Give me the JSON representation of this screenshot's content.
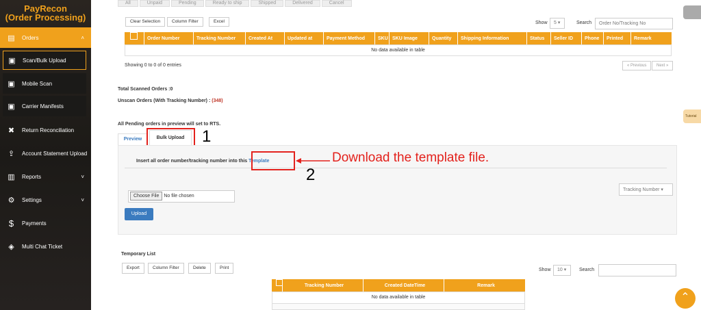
{
  "sidebar": {
    "brand_line1": "PayRecon",
    "brand_line2": "(Order Processing)",
    "items": [
      {
        "label": "Orders",
        "icon": "clipboard-icon"
      },
      {
        "label": "Scan/Bulk Upload",
        "icon": "document-icon"
      },
      {
        "label": "Mobile Scan",
        "icon": "document-icon"
      },
      {
        "label": "Carrier Manifests",
        "icon": "document-icon"
      },
      {
        "label": "Return Reconciliation",
        "icon": "excel-icon"
      },
      {
        "label": "Account Statement Upload",
        "icon": "upload-icon"
      },
      {
        "label": "Reports",
        "icon": "bar-chart-icon"
      },
      {
        "label": "Settings",
        "icon": "gear-icon"
      },
      {
        "label": "Payments",
        "icon": "dollar-icon"
      },
      {
        "label": "Multi Chat Ticket",
        "icon": "ticket-icon"
      }
    ]
  },
  "top_tabs": [
    "All",
    "Unpaid",
    "Pending",
    "Ready to ship",
    "Shipped",
    "Delivered",
    "Cancel"
  ],
  "orders_table": {
    "buttons": [
      "Clear Selection",
      "Column Filter",
      "Excel"
    ],
    "show_label": "Show",
    "show_value": "5",
    "search_label": "Search",
    "search_placeholder": "Order No/Tracking No",
    "columns": [
      "Order Number",
      "Tracking Number",
      "Created At",
      "Updated at",
      "Payment Method",
      "SKU",
      "SKU Image",
      "Quantity",
      "Shipping Information",
      "Status",
      "Seller ID",
      "Phone",
      "Printed",
      "Remark"
    ],
    "empty_text": "No data available in table",
    "info_text": "Showing 0 to 0 of 0 entries",
    "prev_label": "« Previous",
    "next_label": "Next »"
  },
  "summary": {
    "total_scanned": "Total Scanned Orders :0",
    "unscan_label": "Unscan Orders (With Tracking Number) : ",
    "unscan_count": "(348)",
    "pending_note": "All Pending orders in preview will set to RTS."
  },
  "upload_tabs": {
    "preview": "Preview",
    "bulk_upload": "Bulk Upload"
  },
  "bulk_panel": {
    "instruction": "Insert all order number/tracking number into this ",
    "template_link": "Template",
    "choose_file": "Choose File",
    "no_file": "No file chosen",
    "type_select": "Tracking Number",
    "upload_button": "Upload"
  },
  "annotations": {
    "step1": "1",
    "step2": "2",
    "callout": "Download the template file."
  },
  "temp_list": {
    "title": "Temporary List",
    "buttons": [
      "Export",
      "Column Filter",
      "Delete",
      "Print"
    ],
    "show_label": "Show",
    "show_value": "10",
    "search_label": "Search",
    "columns": [
      "Tracking Number",
      "Created DateTime",
      "Remark"
    ],
    "empty_text": "No data available in table"
  },
  "side_tab": "Tutorial",
  "colors": {
    "accent": "#f0a11c",
    "annotation": "#e3211c",
    "link": "#3b7bbf"
  }
}
